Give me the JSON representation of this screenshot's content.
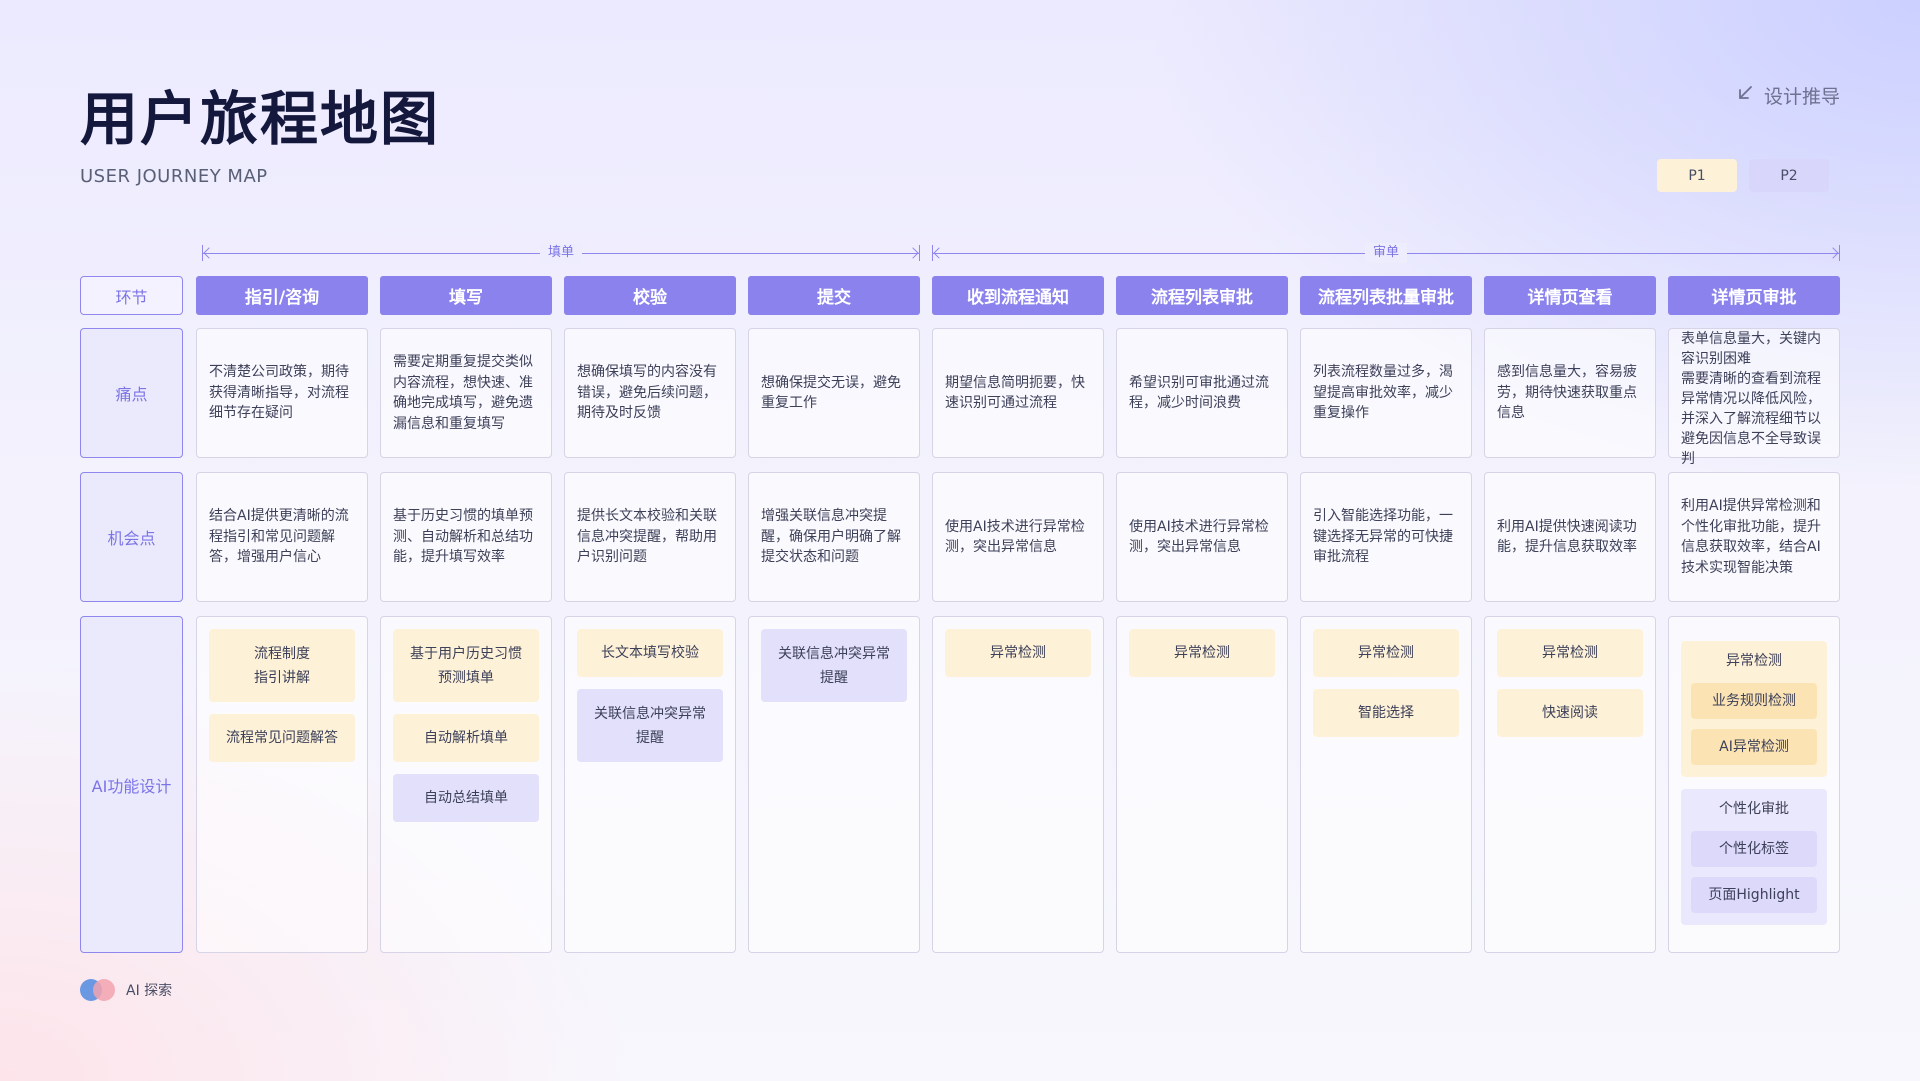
{
  "header": {
    "title": "用户旅程地图",
    "subtitle": "USER JOURNEY MAP",
    "design_link": "设计推导"
  },
  "legend": {
    "p1": "P1",
    "p2": "P2"
  },
  "phases": {
    "fill": "填单",
    "review": "审单"
  },
  "row_labels": {
    "stage": "环节",
    "pain": "痛点",
    "opportunity": "机会点",
    "ai": "AI功能设计"
  },
  "stages": [
    {
      "name": "指引/咨询",
      "pain": "不清楚公司政策，期待获得清晰指导，对流程细节存在疑问",
      "opportunity": "结合AI提供更清晰的流程指引和常见问题解答，增强用户信心",
      "ai": [
        {
          "text": "流程制度\n指引讲解",
          "priority": "p1"
        },
        {
          "text": "流程常见问题解答",
          "priority": "p1"
        }
      ]
    },
    {
      "name": "填写",
      "pain": "需要定期重复提交类似内容流程，想快速、准确地完成填写，避免遗漏信息和重复填写",
      "opportunity": "基于历史习惯的填单预测、自动解析和总结功能，提升填写效率",
      "ai": [
        {
          "text": "基于用户历史习惯\n预测填单",
          "priority": "p1"
        },
        {
          "text": "自动解析填单",
          "priority": "p1"
        },
        {
          "text": "自动总结填单",
          "priority": "p2"
        }
      ]
    },
    {
      "name": "校验",
      "pain": "想确保填写的内容没有错误，避免后续问题，期待及时反馈",
      "opportunity": "提供长文本校验和关联信息冲突提醒，帮助用户识别问题",
      "ai": [
        {
          "text": "长文本填写校验",
          "priority": "p1"
        },
        {
          "text": "关联信息冲突异常\n提醒",
          "priority": "p2"
        }
      ]
    },
    {
      "name": "提交",
      "pain": "想确保提交无误，避免重复工作",
      "opportunity": "增强关联信息冲突提醒，确保用户明确了解提交状态和问题",
      "ai": [
        {
          "text": "关联信息冲突异常\n提醒",
          "priority": "p2"
        }
      ]
    },
    {
      "name": "收到流程通知",
      "pain": "期望信息简明扼要，快速识别可通过流程",
      "opportunity": "使用AI技术进行异常检测，突出异常信息",
      "ai": [
        {
          "text": "异常检测",
          "priority": "p1"
        }
      ]
    },
    {
      "name": "流程列表审批",
      "pain": "希望识别可审批通过流程，减少时间浪费",
      "opportunity": "使用AI技术进行异常检测，突出异常信息",
      "ai": [
        {
          "text": "异常检测",
          "priority": "p1"
        }
      ]
    },
    {
      "name": "流程列表批量审批",
      "pain": "列表流程数量过多，渴望提高审批效率，减少重复操作",
      "opportunity": "引入智能选择功能，一键选择无异常的可快捷审批流程",
      "ai": [
        {
          "text": "异常检测",
          "priority": "p1"
        },
        {
          "text": "智能选择",
          "priority": "p1"
        }
      ]
    },
    {
      "name": "详情页查看",
      "pain": "感到信息量大，容易疲劳，期待快速获取重点信息",
      "opportunity": "利用AI提供快速阅读功能，提升信息获取效率",
      "ai": [
        {
          "text": "异常检测",
          "priority": "p1"
        },
        {
          "text": "快速阅读",
          "priority": "p1"
        }
      ]
    },
    {
      "name": "详情页审批",
      "pain": "表单信息量大，关键内容识别困难\n需要清晰的查看到流程异常情况以降低风险，并深入了解流程细节以避免因信息不全导致误判",
      "opportunity": "利用AI提供异常检测和个性化审批功能，提升信息获取效率，结合AI技术实现智能决策",
      "ai_groups": [
        {
          "title": "异常检测",
          "priority": "p1",
          "items": [
            "业务规则检测",
            "AI异常检测"
          ]
        },
        {
          "title": "个性化审批",
          "priority": "p2",
          "items": [
            "个性化标签",
            "页面Highlight"
          ]
        }
      ]
    }
  ],
  "footer": {
    "label": "AI 探索"
  },
  "colors": {
    "accent": "#8b82ee",
    "p1": "#fdf1d8",
    "p2": "#e2e0fb",
    "title": "#14183c"
  }
}
